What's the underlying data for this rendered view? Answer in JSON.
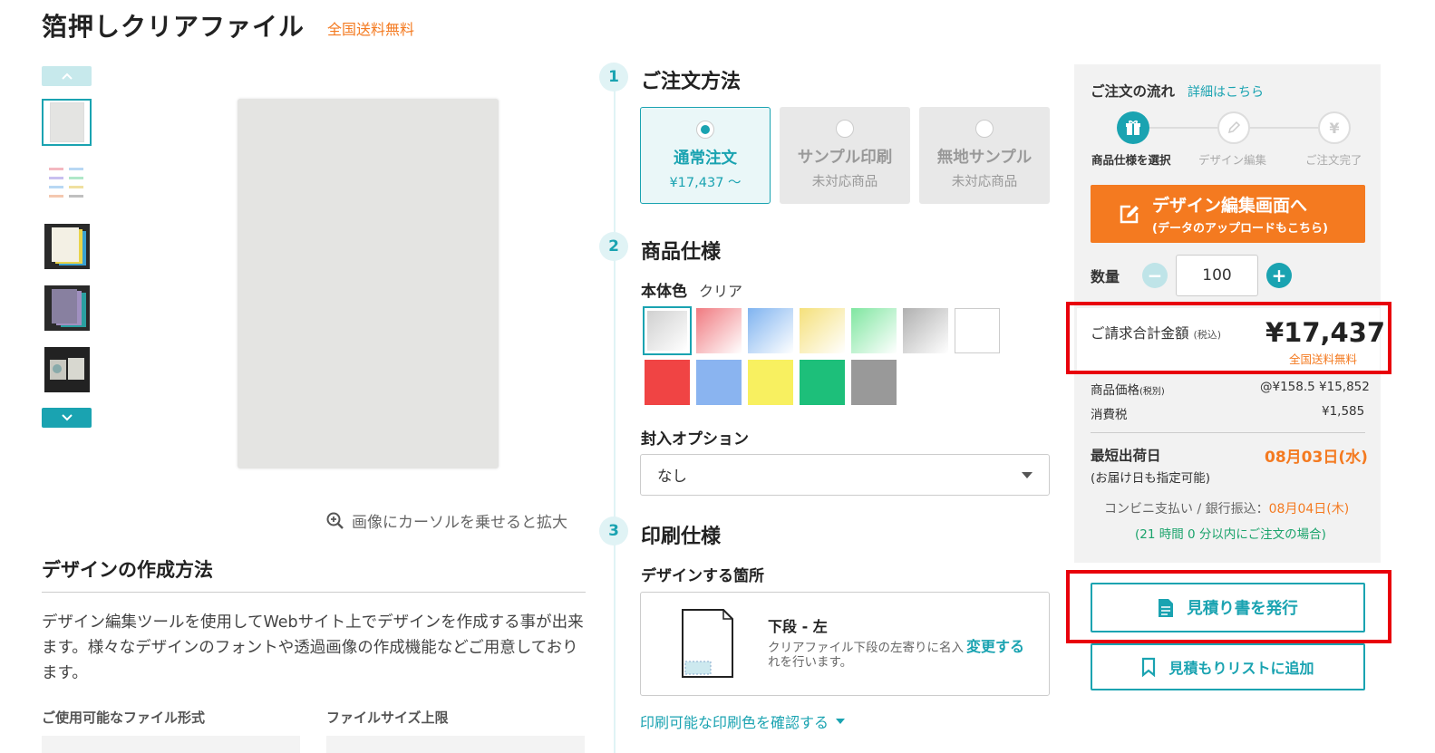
{
  "header": {
    "title": "箔押しクリアファイル",
    "free_shipping": "全国送料無料"
  },
  "gallery": {
    "zoom_hint": "画像にカーソルを乗せると拡大"
  },
  "design_method": {
    "heading": "デザインの作成方法",
    "body": "デザイン編集ツールを使用してWebサイト上でデザインを作成する事が出来ます。様々なデザインのフォントや透過画像の作成機能などご用意しております。",
    "file_formats_label": "ご使用可能なファイル形式",
    "file_size_label": "ファイルサイズ上限"
  },
  "steps": [
    {
      "num": "1",
      "title": "ご注文方法"
    },
    {
      "num": "2",
      "title": "商品仕様"
    },
    {
      "num": "3",
      "title": "印刷仕様"
    }
  ],
  "order_methods": [
    {
      "label": "通常注文",
      "sub": "¥17,437 ～",
      "selected": true
    },
    {
      "label": "サンプル印刷",
      "sub": "未対応商品",
      "selected": false
    },
    {
      "label": "無地サンプル",
      "sub": "未対応商品",
      "selected": false
    }
  ],
  "body_color": {
    "label": "本体色",
    "value": "クリア",
    "swatches_row1": [
      "#d0d0d0",
      "#f07a80",
      "#7fb3f0",
      "#f5e07a",
      "#7fe6a0",
      "#b0b0b0",
      "#ffffff"
    ],
    "swatches_row2": [
      "#f04444",
      "#8ab4f0",
      "#f8f060",
      "#1dbf7a",
      "#999999"
    ]
  },
  "insert_option": {
    "label": "封入オプション",
    "value": "なし"
  },
  "print_spec": {
    "location_label": "デザインする箇所",
    "location_title": "下段 - 左",
    "location_desc": "クリアファイル下段の左寄りに名入れを行います。",
    "change": "変更する",
    "confirm_colors": "印刷可能な印刷色を確認する"
  },
  "flow": {
    "title": "ご注文の流れ",
    "link": "詳細はこちら",
    "steps": [
      "商品仕様を選択",
      "デザイン編集",
      "ご注文完了"
    ]
  },
  "edit_button": {
    "line1": "デザイン編集画面へ",
    "line2": "(データのアップロードもこちら)"
  },
  "quantity": {
    "label": "数量",
    "value": "100"
  },
  "total": {
    "label": "ご請求合計金額",
    "tax_note": "(税込)",
    "price": "¥17,437",
    "free_shipping": "全国送料無料"
  },
  "breakdown": {
    "product_label": "商品価格",
    "product_tax_note": "(税別)",
    "product_value": "@¥158.5 ¥15,852",
    "tax_label": "消費税",
    "tax_value": "¥1,585"
  },
  "shipping": {
    "label": "最短出荷日",
    "sub": "(お届け日も指定可能)",
    "date": "08月03日(水)",
    "conv_prefix": "コンビニ支払い / 銀行振込：",
    "conv_date": "08月04日(木)",
    "note": "(21 時間 0 分以内にご注文の場合)"
  },
  "actions": {
    "estimate": "見積り書を発行",
    "add_list": "見積もりリストに追加"
  },
  "colors": {
    "accent": "#1aa3b1",
    "orange": "#f47a20",
    "highlight": "#e8000b"
  }
}
